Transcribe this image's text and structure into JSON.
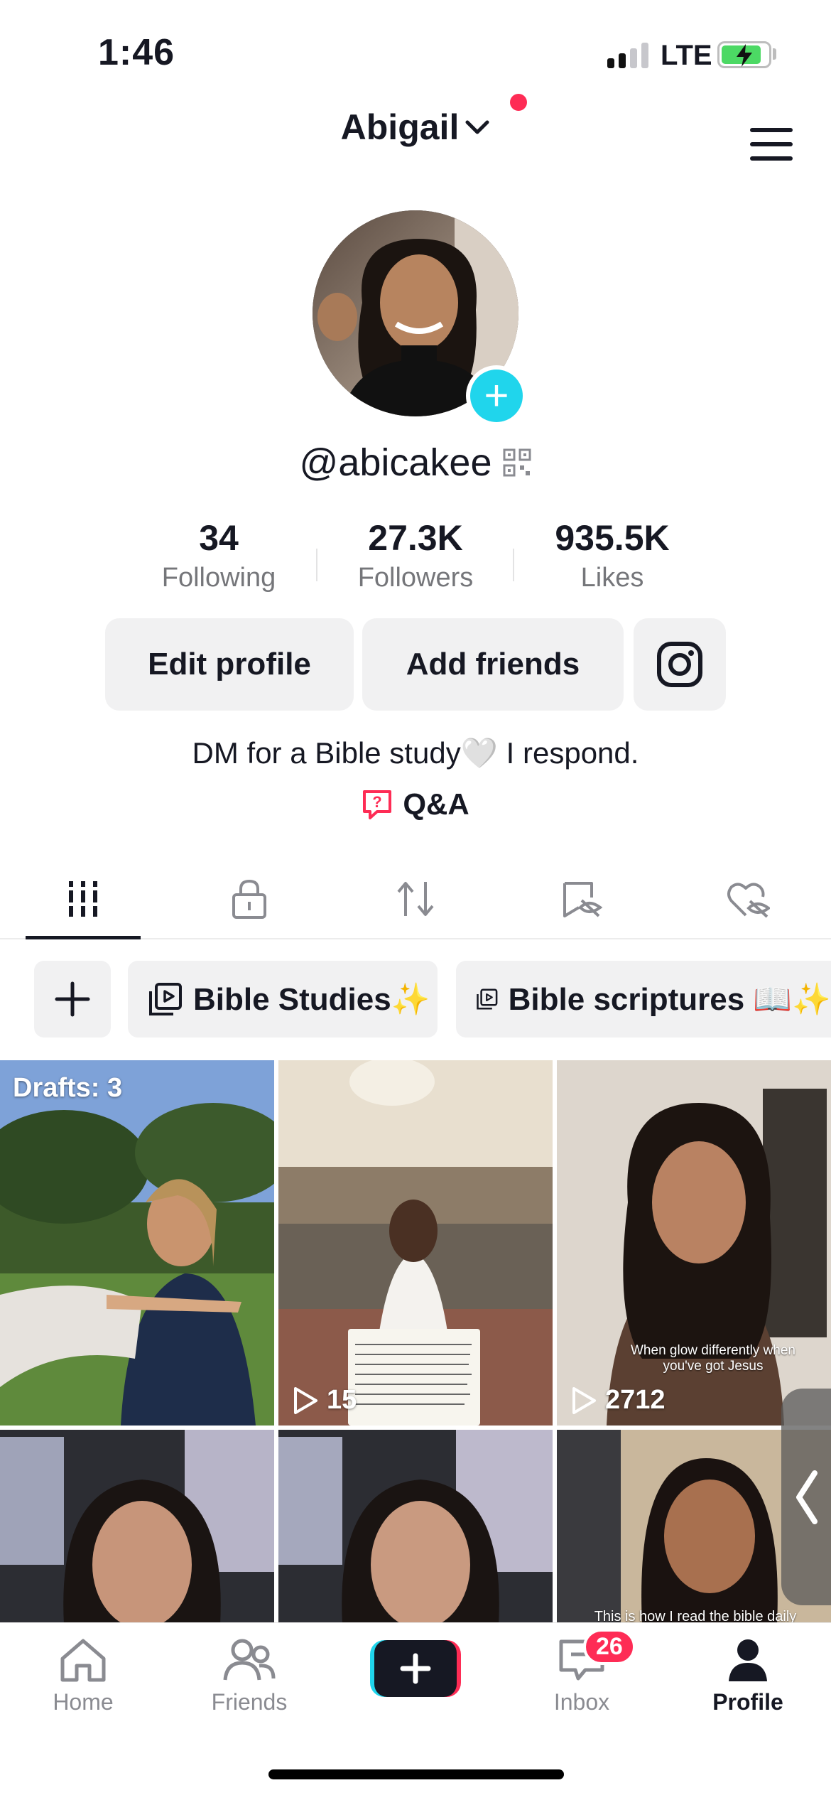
{
  "status": {
    "time": "1:46",
    "network": "LTE"
  },
  "header": {
    "account_name": "Abigail"
  },
  "profile": {
    "handle": "@abicakee",
    "following_count": "34",
    "following_label": "Following",
    "followers_count": "27.3K",
    "followers_label": "Followers",
    "likes_count": "935.5K",
    "likes_label": "Likes",
    "edit_profile_label": "Edit profile",
    "add_friends_label": "Add friends",
    "bio": "DM for a Bible study🤍 I respond.",
    "qa_label": "Q&A"
  },
  "tabs": [
    "videos-icon",
    "lock-icon",
    "repost-icon",
    "saved-icon",
    "liked-icon"
  ],
  "playlists": [
    {
      "label": "Bible Studies✨"
    },
    {
      "label": "Bible scriptures 📖✨"
    }
  ],
  "grid": {
    "drafts_label": "Drafts: 3",
    "tiles": [
      {
        "views": ""
      },
      {
        "views": "15"
      },
      {
        "views": "2712",
        "caption": "When glow differently when you've got Jesus"
      },
      {
        "views": ""
      },
      {
        "views": ""
      },
      {
        "views": "",
        "caption": "This is how I read the bible daily"
      }
    ]
  },
  "nav": {
    "home": "Home",
    "friends": "Friends",
    "inbox": "Inbox",
    "inbox_badge": "26",
    "profile": "Profile"
  },
  "colors": {
    "accent": "#fe2c55",
    "cyan": "#20d5ec",
    "chip_bg": "#f1f1f2"
  }
}
